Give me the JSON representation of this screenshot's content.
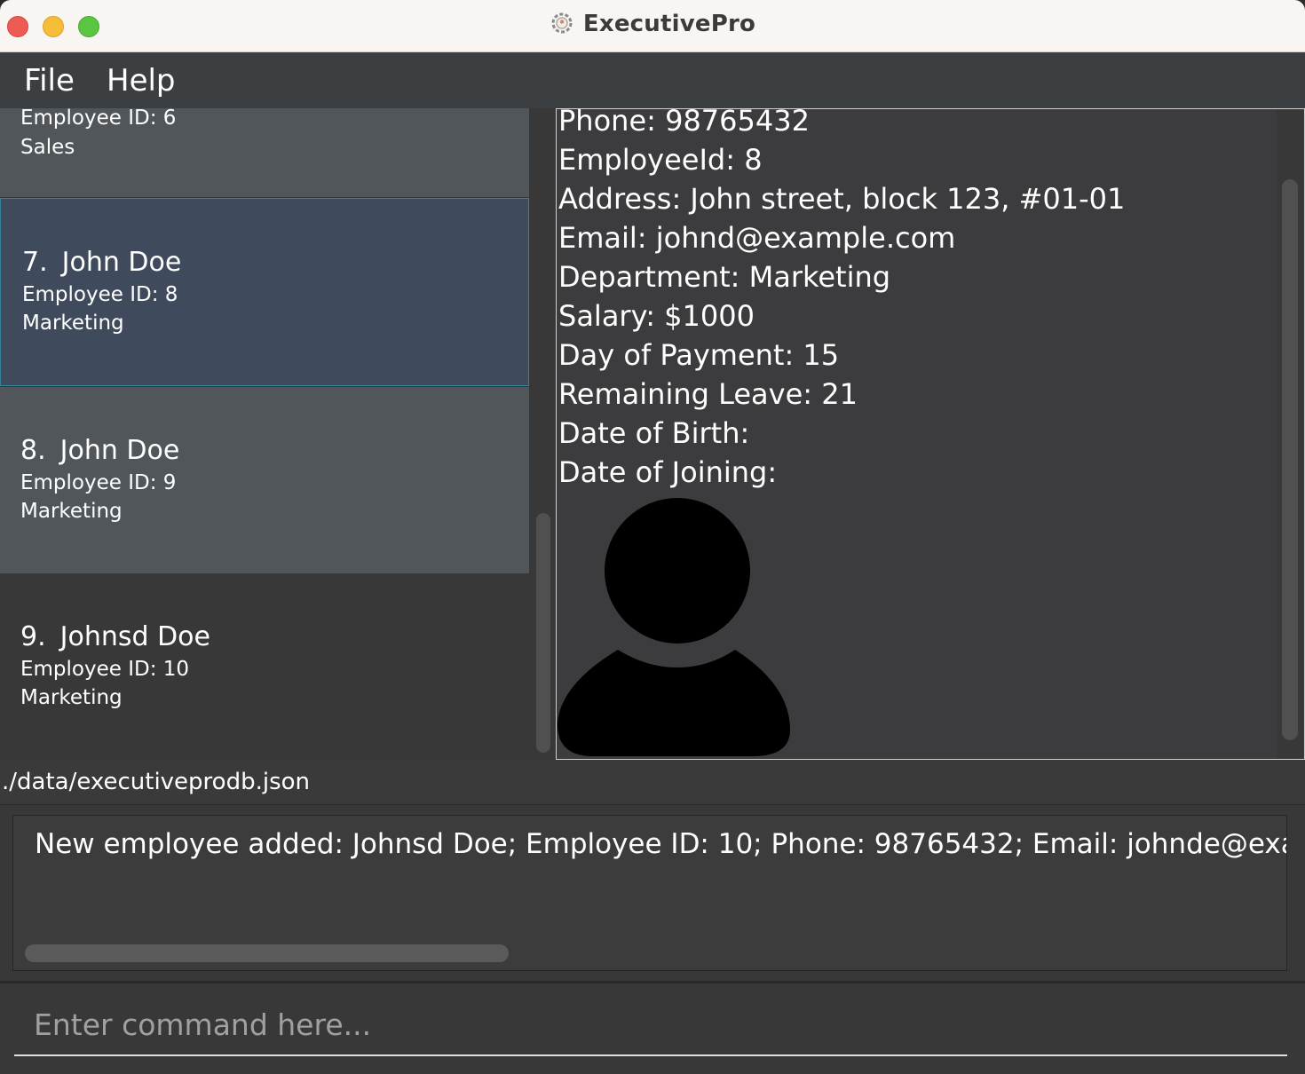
{
  "window": {
    "title": "ExecutivePro",
    "app_icon": "gear-icon"
  },
  "menu": {
    "file": "File",
    "help": "Help"
  },
  "employee_list": [
    {
      "index": "",
      "name": "",
      "employee_id": "Employee ID: 6",
      "department": "Sales"
    },
    {
      "index": "7.",
      "name": "John Doe",
      "employee_id": "Employee ID: 8",
      "department": "Marketing",
      "selected": true
    },
    {
      "index": "8.",
      "name": "John Doe",
      "employee_id": "Employee ID: 9",
      "department": "Marketing"
    },
    {
      "index": "9.",
      "name": "Johnsd Doe",
      "employee_id": "Employee ID: 10",
      "department": "Marketing"
    }
  ],
  "details": {
    "phone": "Phone: 98765432",
    "employee_id": "EmployeeId: 8",
    "address": "Address: John street, block 123, #01-01",
    "email": "Email: johnd@example.com",
    "department": "Department: Marketing",
    "salary": "Salary: $1000",
    "day_of_payment": "Day of Payment: 15",
    "remaining_leave": "Remaining Leave: 21",
    "date_of_birth": "Date of Birth:",
    "date_of_joining": "Date of Joining:",
    "avatar_icon": "person-icon"
  },
  "status_bar": {
    "file_path": "./data/executiveprodb.json"
  },
  "result_display": {
    "text": "New employee added: Johnsd Doe; Employee ID: 10; Phone: 98765432; Email: johnde@example."
  },
  "command_box": {
    "placeholder": "Enter command here...",
    "value": ""
  },
  "colors": {
    "list_card_alt": "#50565a",
    "list_card_selected": "#3f4b5c",
    "selected_border": "#36829a",
    "background": "#383838"
  }
}
